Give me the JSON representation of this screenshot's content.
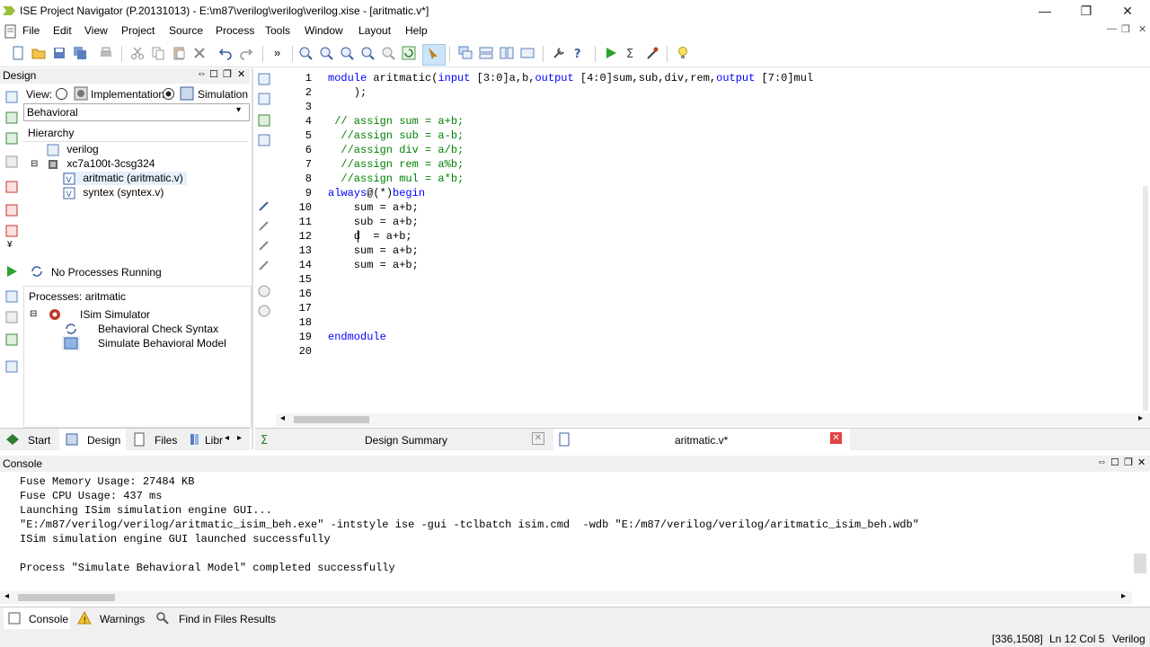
{
  "window": {
    "title": "ISE Project Navigator (P.20131013) - E:\\m87\\verilog\\verilog\\verilog.xise - [aritmatic.v*]",
    "minimize": "—",
    "restore": "❐",
    "close": "✕"
  },
  "menu": [
    "File",
    "Edit",
    "View",
    "Project",
    "Source",
    "Process",
    "Tools",
    "Window",
    "Layout",
    "Help"
  ],
  "design_panel": {
    "title": "Design",
    "view_label": "View:",
    "implementation_label": "Implementation",
    "simulation_label": "Simulation",
    "source_select_value": "Behavioral",
    "hierarchy_label": "Hierarchy",
    "tree": [
      "verilog",
      "xc7a100t-3csg324",
      "aritmatic (aritmatic.v)",
      "syntex (syntex.v)"
    ],
    "no_processes": "No Processes Running",
    "processes_title": "Processes: aritmatic",
    "processes": [
      "ISim Simulator",
      "Behavioral Check Syntax",
      "Simulate Behavioral Model"
    ],
    "tabs": [
      "Start",
      "Design",
      "Files",
      "Libr"
    ]
  },
  "editor": {
    "line_numbers": [
      "1",
      "2",
      "3",
      "4",
      "5",
      "6",
      "7",
      "8",
      "9",
      "10",
      "11",
      "12",
      "13",
      "14",
      "15",
      "16",
      "17",
      "18",
      "19",
      "20"
    ],
    "lines": {
      "l1_kw": "module",
      "l1_a": " aritmatic(",
      "l1_in": "input",
      "l1_b": " [3:0]a,b,",
      "l1_out1": "output",
      "l1_c": " [4:0]sum,sub,div,rem,",
      "l1_out2": "output",
      "l1_d": " [7:0]mul",
      "l2": "    );",
      "l3": "",
      "l4": " // assign sum = a+b;",
      "l5": "  //assign sub = a-b;",
      "l6": "  //assign div = a/b;",
      "l7": "  //assign rem = a%b;",
      "l8": "  //assign mul = a*b;",
      "l9_kw": "always",
      "l9_b": "@(*)",
      "l9_kw2": "begin",
      "l10": "    sum = a+b;",
      "l11": "    sub = a+b;",
      "l12": "    d  = a+b;",
      "l13": "    sum = a+b;",
      "l14": "    sum = a+b;",
      "l19": "endmodule"
    },
    "tabs": [
      "Design Summary",
      "aritmatic.v*"
    ]
  },
  "console": {
    "title": "Console",
    "lines": [
      "Fuse Memory Usage: 27484 KB",
      "Fuse CPU Usage: 437 ms",
      "Launching ISim simulation engine GUI...",
      "\"E:/m87/verilog/verilog/aritmatic_isim_beh.exe\" -intstyle ise -gui -tclbatch isim.cmd  -wdb \"E:/m87/verilog/verilog/aritmatic_isim_beh.wdb\"",
      "ISim simulation engine GUI launched successfully",
      "",
      "Process \"Simulate Behavioral Model\" completed successfully"
    ],
    "tabs": [
      "Console",
      "Warnings",
      "Find in Files Results"
    ]
  },
  "status": {
    "coords": "[336,1508]",
    "position": "Ln 12 Col 5",
    "language": "Verilog"
  },
  "colors": {
    "keyword": "#0000ff",
    "comment": "#008000",
    "close_tab": "#e04343"
  }
}
